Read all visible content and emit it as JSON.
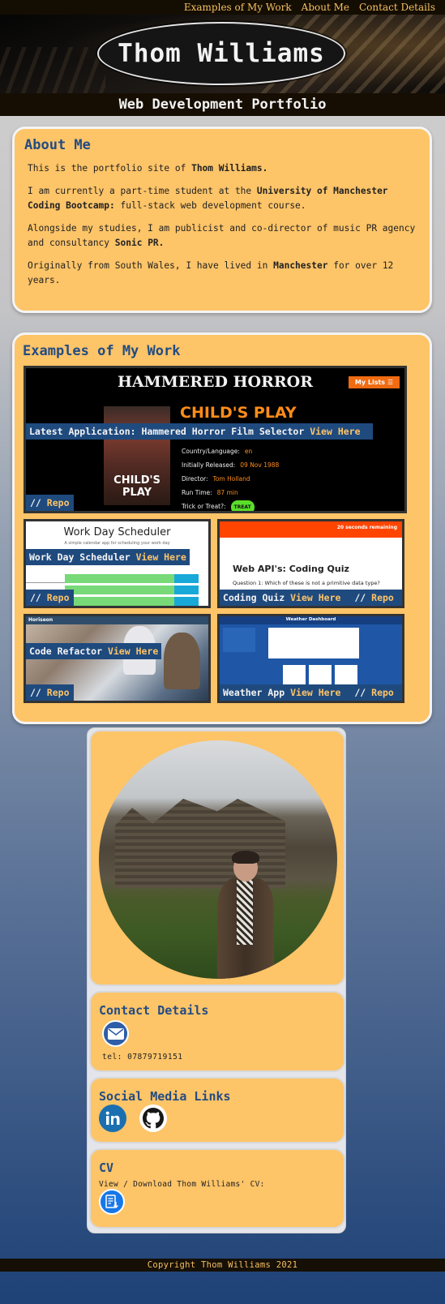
{
  "nav": {
    "items": [
      "Examples of My Work",
      "About Me",
      "Contact Details"
    ]
  },
  "header": {
    "name": "Thom Williams",
    "subtitle": "Web Development Portfolio"
  },
  "about": {
    "title": "About Me",
    "p1_a": "This is the portfolio site of ",
    "p1_b": "Thom Williams.",
    "p2_a": "I am currently a part-time student at the ",
    "p2_b": "University of Manchester Coding Bootcamp:",
    "p2_c": " full-stack web development course.",
    "p3_a": "Alongside my studies, I am publicist and co-director of music PR agency and consultancy ",
    "p3_b": "Sonic PR.",
    "p4_a": "Originally from South Wales, I have lived in ",
    "p4_b": "Manchester",
    "p4_c": " for over 12 years."
  },
  "work": {
    "title": "Examples of My Work",
    "view_here": "View Here",
    "repo_prefix": "//",
    "repo_label": "Repo",
    "projects": [
      {
        "label": "Latest Application: Hammered Horror Film Selector",
        "screenshot": {
          "title": "HAMMERED HORROR",
          "lists_button": "My Lists ☰",
          "movie": "CHILD'S PLAY",
          "poster_title": "CHILD'S PLAY",
          "rows": [
            {
              "k": "Country/Language:",
              "v": "en"
            },
            {
              "k": "Initially Released:",
              "v": "09 Nov 1988"
            },
            {
              "k": "Director:",
              "v": "Tom Holland"
            },
            {
              "k": "Run Time:",
              "v": "87 min"
            },
            {
              "k": "Trick or Treat?:",
              "v": ""
            }
          ],
          "treat_badge": "TREAT"
        }
      },
      {
        "label": "Work Day Scheduler",
        "screenshot": {
          "title": "Work Day Scheduler",
          "subtitle": "A simple calendar app for scheduling your work day"
        }
      },
      {
        "label": "Coding Quiz",
        "screenshot": {
          "timer": "20 seconds remaining",
          "heading": "Web API's: Coding Quiz",
          "question": "Question 1: Which of these is not a primitive data type?"
        }
      },
      {
        "label": "Code Refactor",
        "screenshot": {
          "brand": "Horiseon"
        }
      },
      {
        "label": "Weather App",
        "screenshot": {
          "title": "Weather Dashboard"
        }
      }
    ]
  },
  "contact": {
    "title": "Contact Details",
    "icon": "mail-icon",
    "tel": "tel: 07879719151"
  },
  "social": {
    "title": "Social Media Links",
    "icons": [
      "linkedin-icon",
      "github-icon"
    ]
  },
  "cv": {
    "title": "CV",
    "text": "View / Download Thom Williams' CV:",
    "icon": "document-download-icon"
  },
  "footer": {
    "text": "Copyright Thom Williams 2021"
  },
  "colors": {
    "accent": "#fdc468",
    "heading": "#234c82",
    "label_bg": "#1f4a7e",
    "bar_bg": "#160e02",
    "nav_text": "#f5c063"
  }
}
